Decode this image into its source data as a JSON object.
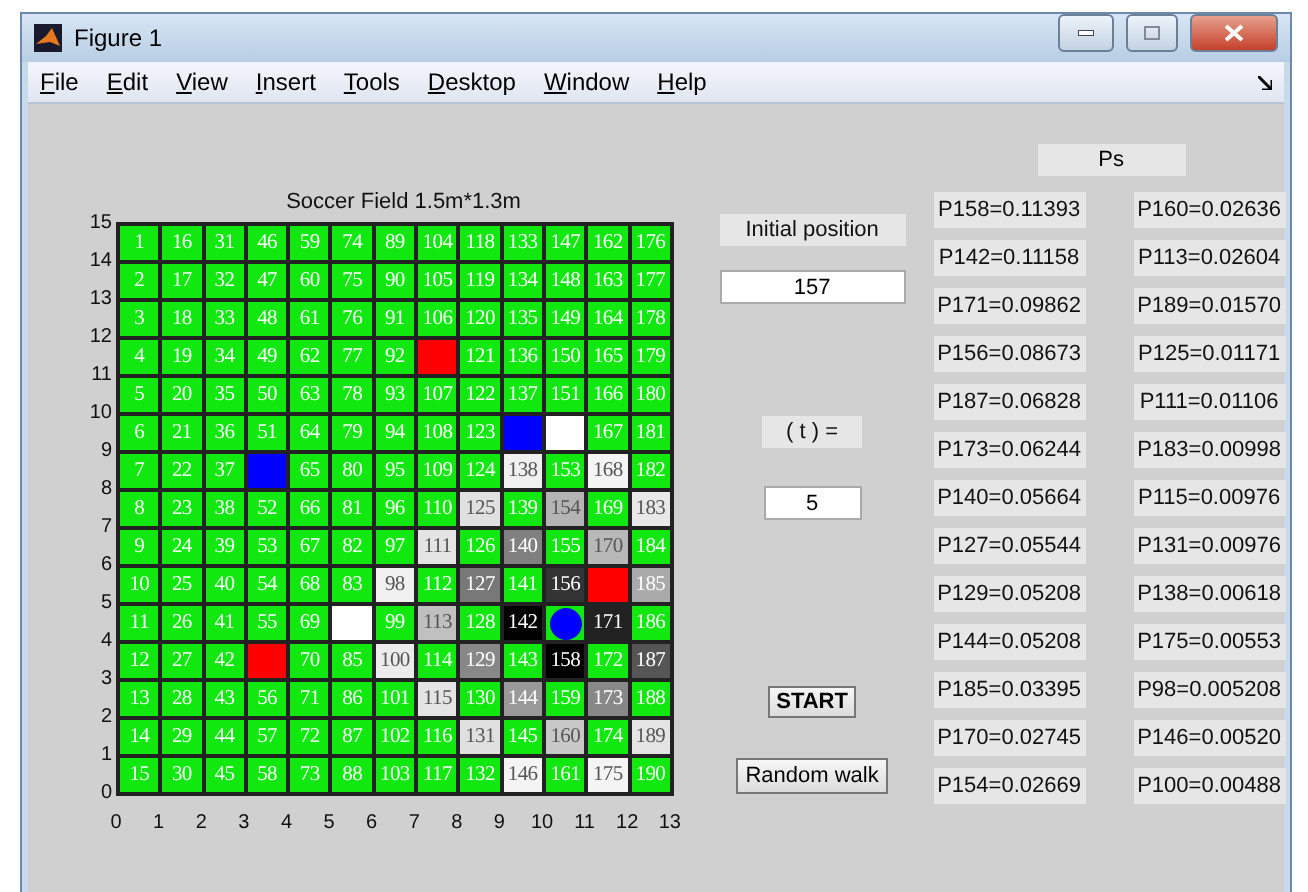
{
  "window": {
    "title": "Figure 1"
  },
  "menu": [
    "File",
    "Edit",
    "View",
    "Insert",
    "Tools",
    "Desktop",
    "Window",
    "Help"
  ],
  "field": {
    "title": "Soccer Field 1.5m*1.3m",
    "xticks": [
      "0",
      "1",
      "2",
      "3",
      "4",
      "5",
      "6",
      "7",
      "8",
      "9",
      "10",
      "11",
      "12",
      "13"
    ],
    "yticks": [
      "15",
      "14",
      "13",
      "12",
      "11",
      "10",
      "9",
      "8",
      "7",
      "6",
      "5",
      "4",
      "3",
      "2",
      "1",
      "0"
    ],
    "rows": [
      {
        "cells": [
          {
            "t": "1",
            "color": "#10e810"
          },
          {
            "t": "16",
            "color": "#10e810"
          },
          {
            "t": "31",
            "color": "#10e810"
          },
          {
            "t": "46",
            "color": "#10e810"
          },
          {
            "t": "59",
            "color": "#10e810"
          },
          {
            "t": "74",
            "color": "#10e810"
          },
          {
            "t": "89",
            "color": "#10e810"
          },
          {
            "t": "104",
            "color": "#10e810"
          },
          {
            "t": "118",
            "color": "#10e810"
          },
          {
            "t": "133",
            "color": "#10e810"
          },
          {
            "t": "147",
            "color": "#10e810"
          },
          {
            "t": "162",
            "color": "#10e810"
          },
          {
            "t": "176",
            "color": "#10e810"
          }
        ]
      },
      {
        "cells": [
          {
            "t": "2",
            "color": "#10e810"
          },
          {
            "t": "17",
            "color": "#10e810"
          },
          {
            "t": "32",
            "color": "#10e810"
          },
          {
            "t": "47",
            "color": "#10e810"
          },
          {
            "t": "60",
            "color": "#10e810"
          },
          {
            "t": "75",
            "color": "#10e810"
          },
          {
            "t": "90",
            "color": "#10e810"
          },
          {
            "t": "105",
            "color": "#10e810"
          },
          {
            "t": "119",
            "color": "#10e810"
          },
          {
            "t": "134",
            "color": "#10e810"
          },
          {
            "t": "148",
            "color": "#10e810"
          },
          {
            "t": "163",
            "color": "#10e810"
          },
          {
            "t": "177",
            "color": "#10e810"
          }
        ]
      },
      {
        "cells": [
          {
            "t": "3",
            "color": "#10e810"
          },
          {
            "t": "18",
            "color": "#10e810"
          },
          {
            "t": "33",
            "color": "#10e810"
          },
          {
            "t": "48",
            "color": "#10e810"
          },
          {
            "t": "61",
            "color": "#10e810"
          },
          {
            "t": "76",
            "color": "#10e810"
          },
          {
            "t": "91",
            "color": "#10e810"
          },
          {
            "t": "106",
            "color": "#10e810"
          },
          {
            "t": "120",
            "color": "#10e810"
          },
          {
            "t": "135",
            "color": "#10e810"
          },
          {
            "t": "149",
            "color": "#10e810"
          },
          {
            "t": "164",
            "color": "#10e810"
          },
          {
            "t": "178",
            "color": "#10e810"
          }
        ]
      },
      {
        "cells": [
          {
            "t": "4",
            "color": "#10e810"
          },
          {
            "t": "19",
            "color": "#10e810"
          },
          {
            "t": "34",
            "color": "#10e810"
          },
          {
            "t": "49",
            "color": "#10e810"
          },
          {
            "t": "62",
            "color": "#10e810"
          },
          {
            "t": "77",
            "color": "#10e810"
          },
          {
            "t": "92",
            "color": "#10e810"
          },
          {
            "color": "#ff0000"
          },
          {
            "t": "121",
            "color": "#10e810"
          },
          {
            "t": "136",
            "color": "#10e810"
          },
          {
            "t": "150",
            "color": "#10e810"
          },
          {
            "t": "165",
            "color": "#10e810"
          },
          {
            "t": "179",
            "color": "#10e810"
          }
        ]
      },
      {
        "cells": [
          {
            "t": "5",
            "color": "#10e810"
          },
          {
            "t": "20",
            "color": "#10e810"
          },
          {
            "t": "35",
            "color": "#10e810"
          },
          {
            "t": "50",
            "color": "#10e810"
          },
          {
            "t": "63",
            "color": "#10e810"
          },
          {
            "t": "78",
            "color": "#10e810"
          },
          {
            "t": "93",
            "color": "#10e810"
          },
          {
            "t": "107",
            "color": "#10e810"
          },
          {
            "t": "122",
            "color": "#10e810"
          },
          {
            "t": "137",
            "color": "#10e810"
          },
          {
            "t": "151",
            "color": "#10e810"
          },
          {
            "t": "166",
            "color": "#10e810"
          },
          {
            "t": "180",
            "color": "#10e810"
          }
        ]
      },
      {
        "cells": [
          {
            "t": "6",
            "color": "#10e810"
          },
          {
            "t": "21",
            "color": "#10e810"
          },
          {
            "t": "36",
            "color": "#10e810"
          },
          {
            "t": "51",
            "color": "#10e810"
          },
          {
            "t": "64",
            "color": "#10e810"
          },
          {
            "t": "79",
            "color": "#10e810"
          },
          {
            "t": "94",
            "color": "#10e810"
          },
          {
            "t": "108",
            "color": "#10e810"
          },
          {
            "t": "123",
            "color": "#10e810"
          },
          {
            "color": "#0000ff"
          },
          {
            "color": "#ffffff"
          },
          {
            "t": "167",
            "color": "#10e810"
          },
          {
            "t": "181",
            "color": "#10e810"
          }
        ]
      },
      {
        "cells": [
          {
            "t": "7",
            "color": "#10e810"
          },
          {
            "t": "22",
            "color": "#10e810"
          },
          {
            "t": "37",
            "color": "#10e810"
          },
          {
            "color": "#0000ff"
          },
          {
            "t": "65",
            "color": "#10e810"
          },
          {
            "t": "80",
            "color": "#10e810"
          },
          {
            "t": "95",
            "color": "#10e810"
          },
          {
            "t": "109",
            "color": "#10e810"
          },
          {
            "t": "124",
            "color": "#10e810"
          },
          {
            "t": "138",
            "color": "#f0f0f0"
          },
          {
            "t": "153",
            "color": "#10e810"
          },
          {
            "t": "168",
            "color": "#f4f4f4"
          },
          {
            "t": "182",
            "color": "#10e810"
          }
        ]
      },
      {
        "cells": [
          {
            "t": "8",
            "color": "#10e810"
          },
          {
            "t": "23",
            "color": "#10e810"
          },
          {
            "t": "38",
            "color": "#10e810"
          },
          {
            "t": "52",
            "color": "#10e810"
          },
          {
            "t": "66",
            "color": "#10e810"
          },
          {
            "t": "81",
            "color": "#10e810"
          },
          {
            "t": "96",
            "color": "#10e810"
          },
          {
            "t": "110",
            "color": "#10e810"
          },
          {
            "t": "125",
            "color": "#e0e0e0"
          },
          {
            "t": "139",
            "color": "#10e810"
          },
          {
            "t": "154",
            "color": "#b4b4b4"
          },
          {
            "t": "169",
            "color": "#10e810"
          },
          {
            "t": "183",
            "color": "#e8e8e8"
          }
        ]
      },
      {
        "cells": [
          {
            "t": "9",
            "color": "#10e810"
          },
          {
            "t": "24",
            "color": "#10e810"
          },
          {
            "t": "39",
            "color": "#10e810"
          },
          {
            "t": "53",
            "color": "#10e810"
          },
          {
            "t": "67",
            "color": "#10e810"
          },
          {
            "t": "82",
            "color": "#10e810"
          },
          {
            "t": "97",
            "color": "#10e810"
          },
          {
            "t": "111",
            "color": "#e4e4e4"
          },
          {
            "t": "126",
            "color": "#10e810"
          },
          {
            "t": "140",
            "color": "#808080"
          },
          {
            "t": "155",
            "color": "#10e810"
          },
          {
            "t": "170",
            "color": "#b8b8b8"
          },
          {
            "t": "184",
            "color": "#10e810"
          }
        ]
      },
      {
        "cells": [
          {
            "t": "10",
            "color": "#10e810"
          },
          {
            "t": "25",
            "color": "#10e810"
          },
          {
            "t": "40",
            "color": "#10e810"
          },
          {
            "t": "54",
            "color": "#10e810"
          },
          {
            "t": "68",
            "color": "#10e810"
          },
          {
            "t": "83",
            "color": "#10e810"
          },
          {
            "t": "98",
            "color": "#f0f0f0"
          },
          {
            "t": "112",
            "color": "#10e810"
          },
          {
            "t": "127",
            "color": "#787878"
          },
          {
            "t": "141",
            "color": "#10e810"
          },
          {
            "t": "156",
            "color": "#333333"
          },
          {
            "color": "#ff0000"
          },
          {
            "t": "185",
            "color": "#aaaaaa"
          }
        ]
      },
      {
        "cells": [
          {
            "t": "11",
            "color": "#10e810"
          },
          {
            "t": "26",
            "color": "#10e810"
          },
          {
            "t": "41",
            "color": "#10e810"
          },
          {
            "t": "55",
            "color": "#10e810"
          },
          {
            "t": "69",
            "color": "#10e810"
          },
          {
            "color": "#ffffff"
          },
          {
            "t": "99",
            "color": "#10e810"
          },
          {
            "t": "113",
            "color": "#c0c0c0"
          },
          {
            "t": "128",
            "color": "#10e810"
          },
          {
            "t": "142",
            "color": "#000000"
          },
          {
            "color": "#10e810",
            "ball": true
          },
          {
            "t": "171",
            "color": "#222222"
          },
          {
            "t": "186",
            "color": "#10e810"
          }
        ]
      },
      {
        "cells": [
          {
            "t": "12",
            "color": "#10e810"
          },
          {
            "t": "27",
            "color": "#10e810"
          },
          {
            "t": "42",
            "color": "#10e810"
          },
          {
            "color": "#ff0000"
          },
          {
            "t": "70",
            "color": "#10e810"
          },
          {
            "t": "85",
            "color": "#10e810"
          },
          {
            "t": "100",
            "color": "#ececec"
          },
          {
            "t": "114",
            "color": "#10e810"
          },
          {
            "t": "129",
            "color": "#888888"
          },
          {
            "t": "143",
            "color": "#10e810"
          },
          {
            "t": "158",
            "color": "#000000"
          },
          {
            "t": "172",
            "color": "#10e810"
          },
          {
            "t": "187",
            "color": "#555555"
          }
        ]
      },
      {
        "cells": [
          {
            "t": "13",
            "color": "#10e810"
          },
          {
            "t": "28",
            "color": "#10e810"
          },
          {
            "t": "43",
            "color": "#10e810"
          },
          {
            "t": "56",
            "color": "#10e810"
          },
          {
            "t": "71",
            "color": "#10e810"
          },
          {
            "t": "86",
            "color": "#10e810"
          },
          {
            "t": "101",
            "color": "#10e810"
          },
          {
            "t": "115",
            "color": "#e4e4e4"
          },
          {
            "t": "130",
            "color": "#10e810"
          },
          {
            "t": "144",
            "color": "#999999"
          },
          {
            "t": "159",
            "color": "#10e810"
          },
          {
            "t": "173",
            "color": "#888888"
          },
          {
            "t": "188",
            "color": "#10e810"
          }
        ]
      },
      {
        "cells": [
          {
            "t": "14",
            "color": "#10e810"
          },
          {
            "t": "29",
            "color": "#10e810"
          },
          {
            "t": "44",
            "color": "#10e810"
          },
          {
            "t": "57",
            "color": "#10e810"
          },
          {
            "t": "72",
            "color": "#10e810"
          },
          {
            "t": "87",
            "color": "#10e810"
          },
          {
            "t": "102",
            "color": "#10e810"
          },
          {
            "t": "116",
            "color": "#10e810"
          },
          {
            "t": "131",
            "color": "#e0e0e0"
          },
          {
            "t": "145",
            "color": "#10e810"
          },
          {
            "t": "160",
            "color": "#c8c8c8"
          },
          {
            "t": "174",
            "color": "#10e810"
          },
          {
            "t": "189",
            "color": "#e4e4e4"
          }
        ]
      },
      {
        "cells": [
          {
            "t": "15",
            "color": "#10e810"
          },
          {
            "t": "30",
            "color": "#10e810"
          },
          {
            "t": "45",
            "color": "#10e810"
          },
          {
            "t": "58",
            "color": "#10e810"
          },
          {
            "t": "73",
            "color": "#10e810"
          },
          {
            "t": "88",
            "color": "#10e810"
          },
          {
            "t": "103",
            "color": "#10e810"
          },
          {
            "t": "117",
            "color": "#10e810"
          },
          {
            "t": "132",
            "color": "#10e810"
          },
          {
            "t": "146",
            "color": "#f4f4f4"
          },
          {
            "t": "161",
            "color": "#10e810"
          },
          {
            "t": "175",
            "color": "#f4f4f4"
          },
          {
            "t": "190",
            "color": "#10e810"
          }
        ]
      }
    ]
  },
  "controls": {
    "initial_label": "Initial position",
    "initial_value": "157",
    "t_label": "( t ) =",
    "t_value": "5",
    "start": "START",
    "random_walk": "Random walk"
  },
  "ps": {
    "title": "Ps",
    "left": [
      "P158=0.11393",
      "P142=0.11158",
      "P171=0.09862",
      "P156=0.08673",
      "P187=0.06828",
      "P173=0.06244",
      "P140=0.05664",
      "P127=0.05544",
      "P129=0.05208",
      "P144=0.05208",
      "P185=0.03395",
      "P170=0.02745",
      "P154=0.02669"
    ],
    "right": [
      "P160=0.02636",
      "P113=0.02604",
      "P189=0.01570",
      "P125=0.01171",
      "P111=0.01106",
      "P183=0.00998",
      "P115=0.00976",
      "P131=0.00976",
      "P138=0.00618",
      "P175=0.00553",
      "P98=0.005208",
      "P146=0.00520",
      "P100=0.00488"
    ]
  }
}
